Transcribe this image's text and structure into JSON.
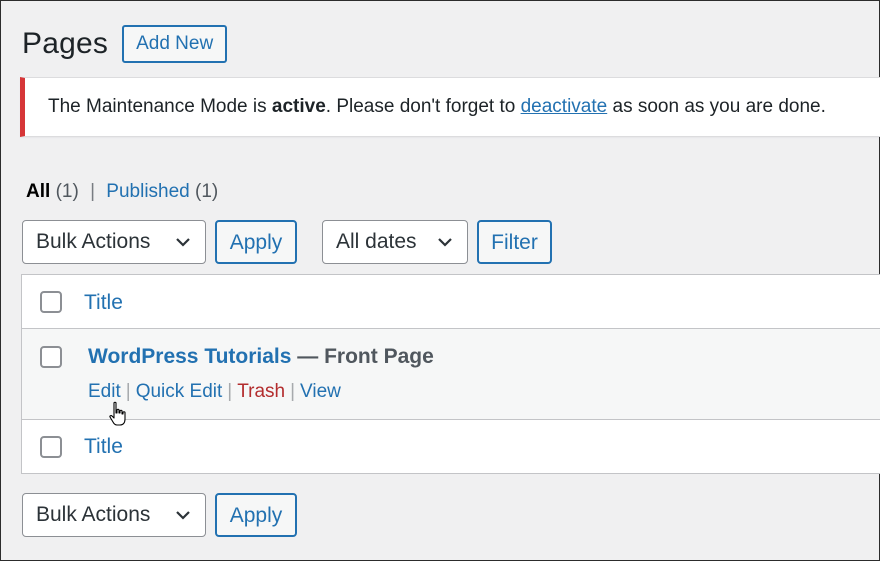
{
  "header": {
    "title": "Pages",
    "add_new_label": "Add New"
  },
  "notice": {
    "text_before": "The Maintenance Mode is ",
    "bold_word": "active",
    "text_middle": ". Please don't forget to ",
    "link_text": "deactivate",
    "text_after": " as soon as you are done.",
    "accent_color": "#d63638"
  },
  "views": {
    "all_label": "All",
    "all_count": "(1)",
    "separator": "|",
    "published_label": "Published",
    "published_count": "(1)"
  },
  "top_nav": {
    "bulk_actions_value": "Bulk Actions",
    "apply_label": "Apply",
    "dates_value": "All dates",
    "filter_label": "Filter"
  },
  "table": {
    "header_title": "Title",
    "footer_title": "Title",
    "rows": [
      {
        "title": "WordPress Tutorials",
        "state": " — Front Page",
        "actions": {
          "edit": "Edit",
          "quick_edit": "Quick Edit",
          "trash": "Trash",
          "view": "View",
          "separator": "|"
        }
      }
    ]
  },
  "bottom_nav": {
    "bulk_actions_value": "Bulk Actions",
    "apply_label": "Apply"
  },
  "colors": {
    "link": "#2271b1",
    "trash": "#b32d2e",
    "background": "#f0f0f1"
  }
}
